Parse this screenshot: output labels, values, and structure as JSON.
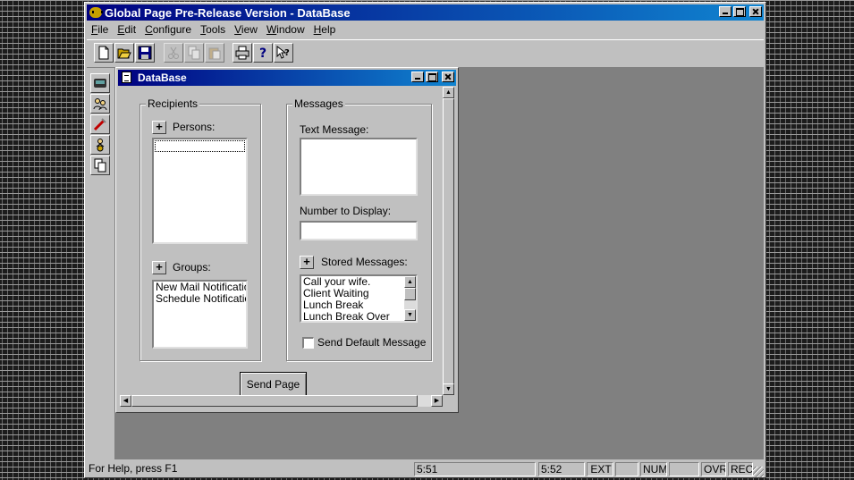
{
  "app": {
    "title": "Global Page Pre-Release Version - DataBase"
  },
  "menu": [
    "File",
    "Edit",
    "Configure",
    "Tools",
    "View",
    "Window",
    "Help"
  ],
  "toolbar_icons": [
    "new-icon",
    "open-icon",
    "save-icon",
    "cut-icon",
    "copy-icon",
    "paste-icon",
    "print-icon",
    "help-icon",
    "context-help-icon"
  ],
  "left_toolbar_icons": [
    "pager-icon",
    "persons-icon",
    "tools-icon",
    "person-icon",
    "copy-pages-icon"
  ],
  "child": {
    "title": "DataBase",
    "recipients": {
      "legend": "Recipients",
      "persons_label": "Persons:",
      "groups_label": "Groups:",
      "groups": [
        "New Mail Notification",
        "Schedule Notification"
      ]
    },
    "messages": {
      "legend": "Messages",
      "text_label": "Text Message:",
      "text_value": "",
      "number_label": "Number to Display:",
      "number_value": "",
      "stored_label": "Stored Messages:",
      "stored": [
        "Call your wife.",
        "Client Waiting",
        "Lunch Break",
        "Lunch Break Over"
      ],
      "default_label": "Send Default Message",
      "default_checked": false
    },
    "send_label": "Send Page",
    "plus": "+"
  },
  "status": {
    "help": "For Help, press F1",
    "time1": "5:51",
    "time2": "5:52",
    "ext": "EXT",
    "num": "NUM",
    "ovr": "OVR",
    "rec": "REC"
  }
}
